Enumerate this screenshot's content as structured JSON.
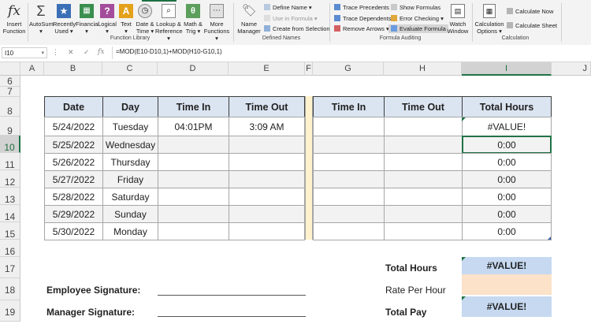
{
  "ribbon": {
    "groups": {
      "function_library": "Function Library",
      "defined_names": "Defined Names",
      "formula_auditing": "Formula Auditing",
      "calculation": "Calculation"
    },
    "buttons": {
      "insert_function": [
        "Insert",
        "Function"
      ],
      "autosum": [
        "AutoSum",
        "▾"
      ],
      "recently_used": [
        "Recently",
        "Used ▾"
      ],
      "financial": [
        "Financial",
        "▾"
      ],
      "logical": [
        "Logical",
        "▾"
      ],
      "text": [
        "Text",
        "▾"
      ],
      "date_time": [
        "Date &",
        "Time ▾"
      ],
      "lookup_reference": [
        "Lookup &",
        "Reference ▾"
      ],
      "math_trig": [
        "Math &",
        "Trig ▾"
      ],
      "more_functions": [
        "More",
        "Functions ▾"
      ],
      "name_manager": [
        "Name",
        "Manager"
      ],
      "watch_window": [
        "Watch",
        "Window"
      ],
      "calculation_options": [
        "Calculation",
        "Options ▾"
      ]
    },
    "items": {
      "define_name": "Define Name ▾",
      "use_in_formula": "Use in Formula ▾",
      "create_from_selection": "Create from Selection",
      "trace_precedents": "Trace Precedents",
      "trace_dependents": "Trace Dependents",
      "remove_arrows": "Remove Arrows ▾",
      "show_formulas": "Show Formulas",
      "error_checking": "Error Checking ▾",
      "evaluate_formula": "Evaluate Formula",
      "calculate_now": "Calculate Now",
      "calculate_sheet": "Calculate Sheet"
    }
  },
  "formula_bar": {
    "name_box": "I10",
    "cancel": "✕",
    "enter": "✓",
    "fx": "fx",
    "formula": "=MOD(E10-D10,1)+MOD(H10-G10,1)"
  },
  "sheet": {
    "columns": [
      "A",
      "B",
      "C",
      "D",
      "E",
      "F",
      "G",
      "H",
      "I",
      "J"
    ],
    "rows": [
      "6",
      "7",
      "8",
      "9",
      "10",
      "11",
      "12",
      "13",
      "14",
      "15",
      "16",
      "17",
      "18",
      "19"
    ],
    "headers": {
      "date": "Date",
      "day": "Day",
      "time_in_1": "Time In",
      "time_out_1": "Time Out",
      "time_in_2": "Time In",
      "time_out_2": "Time Out",
      "total_hours": "Total Hours"
    },
    "data_rows": [
      {
        "date": "5/24/2022",
        "day": "Tuesday",
        "time_in": "04:01PM",
        "time_out": "3:09 AM",
        "time_in_2": "",
        "time_out_2": "",
        "total": "#VALUE!"
      },
      {
        "date": "5/25/2022",
        "day": "Wednesday",
        "time_in": "",
        "time_out": "",
        "time_in_2": "",
        "time_out_2": "",
        "total": "0:00"
      },
      {
        "date": "5/26/2022",
        "day": "Thursday",
        "time_in": "",
        "time_out": "",
        "time_in_2": "",
        "time_out_2": "",
        "total": "0:00"
      },
      {
        "date": "5/27/2022",
        "day": "Friday",
        "time_in": "",
        "time_out": "",
        "time_in_2": "",
        "time_out_2": "",
        "total": "0:00"
      },
      {
        "date": "5/28/2022",
        "day": "Saturday",
        "time_in": "",
        "time_out": "",
        "time_in_2": "",
        "time_out_2": "",
        "total": "0:00"
      },
      {
        "date": "5/29/2022",
        "day": "Sunday",
        "time_in": "",
        "time_out": "",
        "time_in_2": "",
        "time_out_2": "",
        "total": "0:00"
      },
      {
        "date": "5/30/2022",
        "day": "Monday",
        "time_in": "",
        "time_out": "",
        "time_in_2": "",
        "time_out_2": "",
        "total": "0:00"
      }
    ],
    "summary": {
      "total_hours_label": "Total Hours",
      "total_hours_value": "#VALUE!",
      "rate_label": "Rate Per Hour",
      "rate_value": "",
      "total_pay_label": "Total Pay",
      "total_pay_value": "#VALUE!"
    },
    "signatures": {
      "employee": "Employee Signature:",
      "manager": "Manager Signature:"
    }
  },
  "colors": {
    "header_fill": "#dbe5f1",
    "divider_fill": "#fff2cc",
    "summary_blue": "#c6d9f1",
    "summary_peach": "#fbe2c9",
    "excel_green": "#217346"
  }
}
